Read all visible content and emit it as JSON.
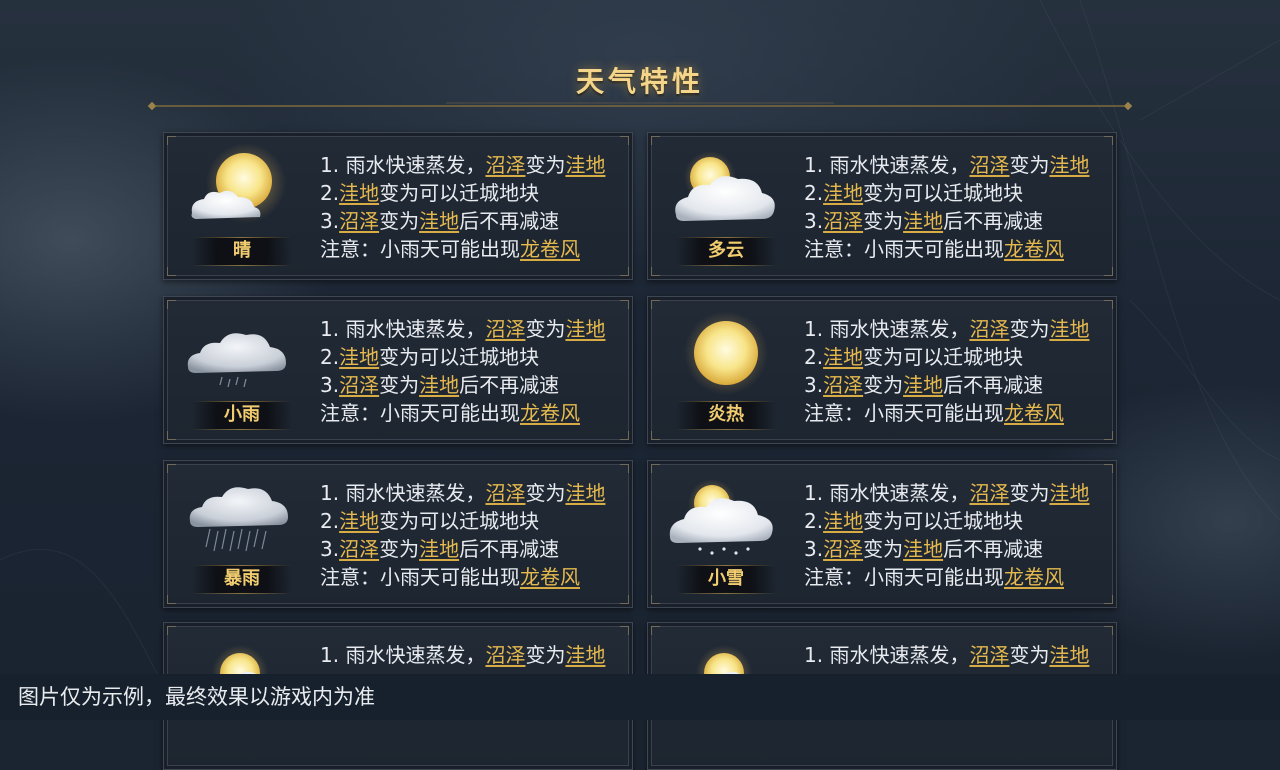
{
  "title": "天气特性",
  "footer_note": "图片仅为示例，最终效果以游戏内为准",
  "cards": [
    {
      "name": "晴",
      "icon": "sun-cloud-icon"
    },
    {
      "name": "多云",
      "icon": "cloudy-icon"
    },
    {
      "name": "小雨",
      "icon": "light-rain-icon"
    },
    {
      "name": "炎热",
      "icon": "hot-sun-icon"
    },
    {
      "name": "暴雨",
      "icon": "heavy-rain-icon"
    },
    {
      "name": "小雪",
      "icon": "light-snow-icon"
    },
    {
      "name": "",
      "icon": "sun-cloud-icon"
    },
    {
      "name": "",
      "icon": "sun-cloud-icon"
    }
  ],
  "desc": {
    "l1_num": "1.",
    "l1_a": "雨水快速蒸发，",
    "swamp": "沼泽",
    "becomes": "变为",
    "lowland": "洼地",
    "l2_num": "2.",
    "l2_b": "变为可以迁城地块",
    "l3_num": "3.",
    "l3_b": "后不再减速",
    "note_a": "注意：小雨天可能出现",
    "tornado": "龙卷风"
  },
  "colors": {
    "accent_gold": "#e5b94e",
    "title_gold": "#f4d58a",
    "text": "#e8ebef",
    "card_bg": "#202834"
  }
}
